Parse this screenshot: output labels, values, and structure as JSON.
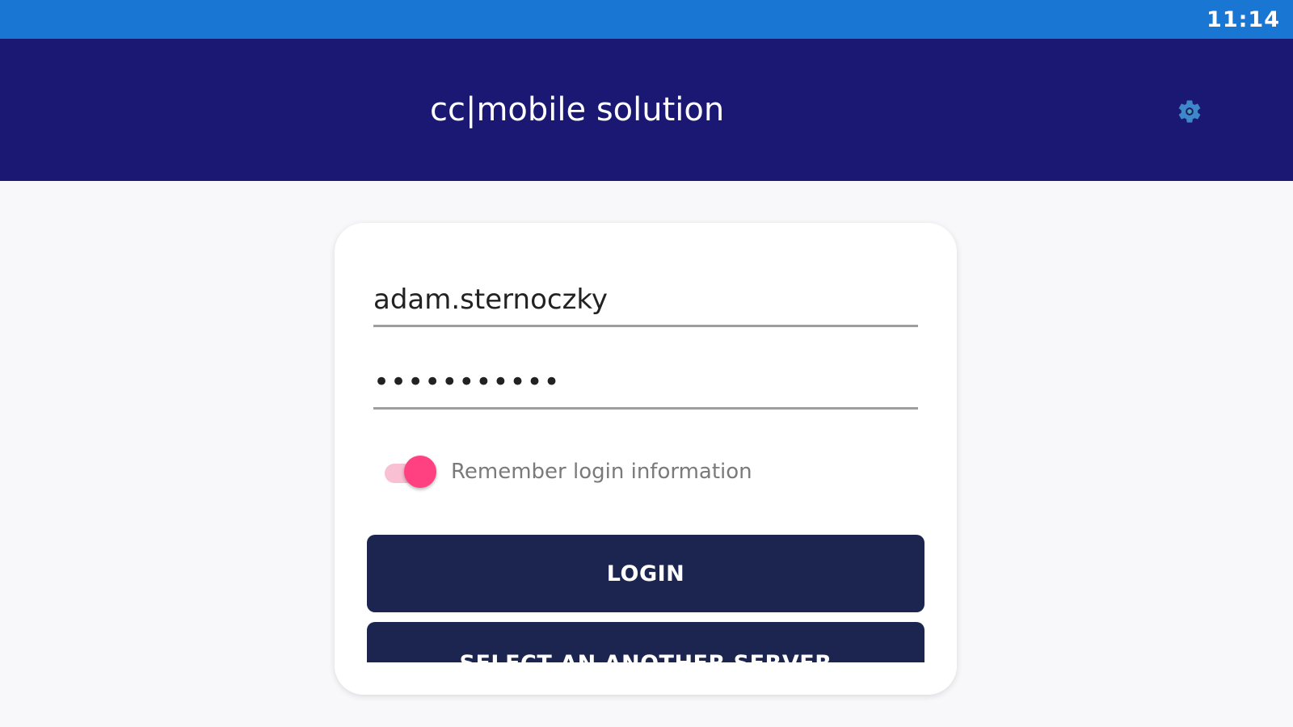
{
  "status_bar": {
    "time": "11:14",
    "color": "#1976d2"
  },
  "app_bar": {
    "title": "cc|mobile solution",
    "settings_icon": "gear-icon",
    "color": "#1a1873"
  },
  "login_form": {
    "username": "adam.sternoczky",
    "password_masked": "•••••••••••",
    "remember_label": "Remember login information",
    "remember_enabled": true,
    "login_button": "LOGIN",
    "server_button": "SELECT AN ANOTHER SERVER",
    "accent_color": "#ff4081",
    "button_color": "#1b2550"
  }
}
